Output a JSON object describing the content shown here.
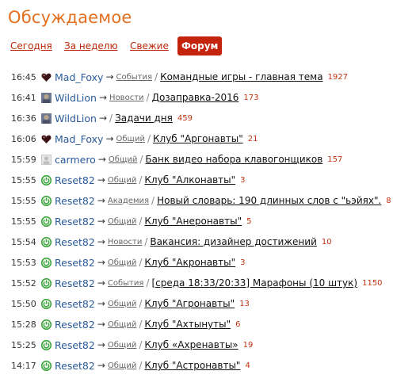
{
  "title": "Обсуждаемое",
  "tabs": [
    "Сегодня",
    "За неделю",
    "Свежие",
    "Форум"
  ],
  "active_tab": "Форум",
  "accent_color": "#c4230e",
  "rows": [
    {
      "time": "16:45",
      "avatar": "heart-avatar-icon",
      "user": "Mad_Foxy",
      "category": "События",
      "topic": "Командные игры - главная тема",
      "count": "1927"
    },
    {
      "time": "16:41",
      "avatar": "photo-avatar-icon",
      "user": "WildLion",
      "category": "Новости",
      "topic": "Дозаправка-2016",
      "count": "173"
    },
    {
      "time": "16:36",
      "avatar": "photo-avatar-icon",
      "user": "WildLion",
      "category": "",
      "topic": "Задачи дня",
      "count": "459"
    },
    {
      "time": "16:06",
      "avatar": "heart-avatar-icon",
      "user": "Mad_Foxy",
      "category": "Общий",
      "topic": "Клуб \"Аргонавты\"",
      "count": "21"
    },
    {
      "time": "15:59",
      "avatar": "generic-avatar-icon",
      "user": "carmero",
      "category": "Общий",
      "topic": "Банк видео набора клавогонщиков",
      "count": "157"
    },
    {
      "time": "15:55",
      "avatar": "power-avatar-icon",
      "user": "Reset82",
      "category": "Общий",
      "topic": "Клуб \"Алконавты\"",
      "count": "3"
    },
    {
      "time": "15:55",
      "avatar": "power-avatar-icon",
      "user": "Reset82",
      "category": "Академия",
      "topic": "Новый словарь: 190 длинных слов с \"ьэйях\".",
      "count": "8"
    },
    {
      "time": "15:55",
      "avatar": "power-avatar-icon",
      "user": "Reset82",
      "category": "Общий",
      "topic": "Клуб \"Анеронавты\"",
      "count": "5"
    },
    {
      "time": "15:54",
      "avatar": "power-avatar-icon",
      "user": "Reset82",
      "category": "Новости",
      "topic": "Вакансия: дизайнер достижений",
      "count": "10"
    },
    {
      "time": "15:53",
      "avatar": "power-avatar-icon",
      "user": "Reset82",
      "category": "Общий",
      "topic": "Клуб \"Акронавты\"",
      "count": "3"
    },
    {
      "time": "15:52",
      "avatar": "power-avatar-icon",
      "user": "Reset82",
      "category": "События",
      "topic": "[среда 18:33/20:33] Марафоны (10 штук)",
      "count": "1150"
    },
    {
      "time": "15:50",
      "avatar": "power-avatar-icon",
      "user": "Reset82",
      "category": "Общий",
      "topic": "Клуб \"Агронавты\"",
      "count": "13"
    },
    {
      "time": "15:28",
      "avatar": "power-avatar-icon",
      "user": "Reset82",
      "category": "Общий",
      "topic": "Клуб \"Ахтынуты\"",
      "count": "6"
    },
    {
      "time": "15:25",
      "avatar": "power-avatar-icon",
      "user": "Reset82",
      "category": "Общий",
      "topic": "Клуб «Ахренавты»",
      "count": "19"
    },
    {
      "time": "14:17",
      "avatar": "power-avatar-icon",
      "user": "Reset82",
      "category": "Общий",
      "topic": "Клуб \"Астронавты\"",
      "count": "4"
    }
  ]
}
